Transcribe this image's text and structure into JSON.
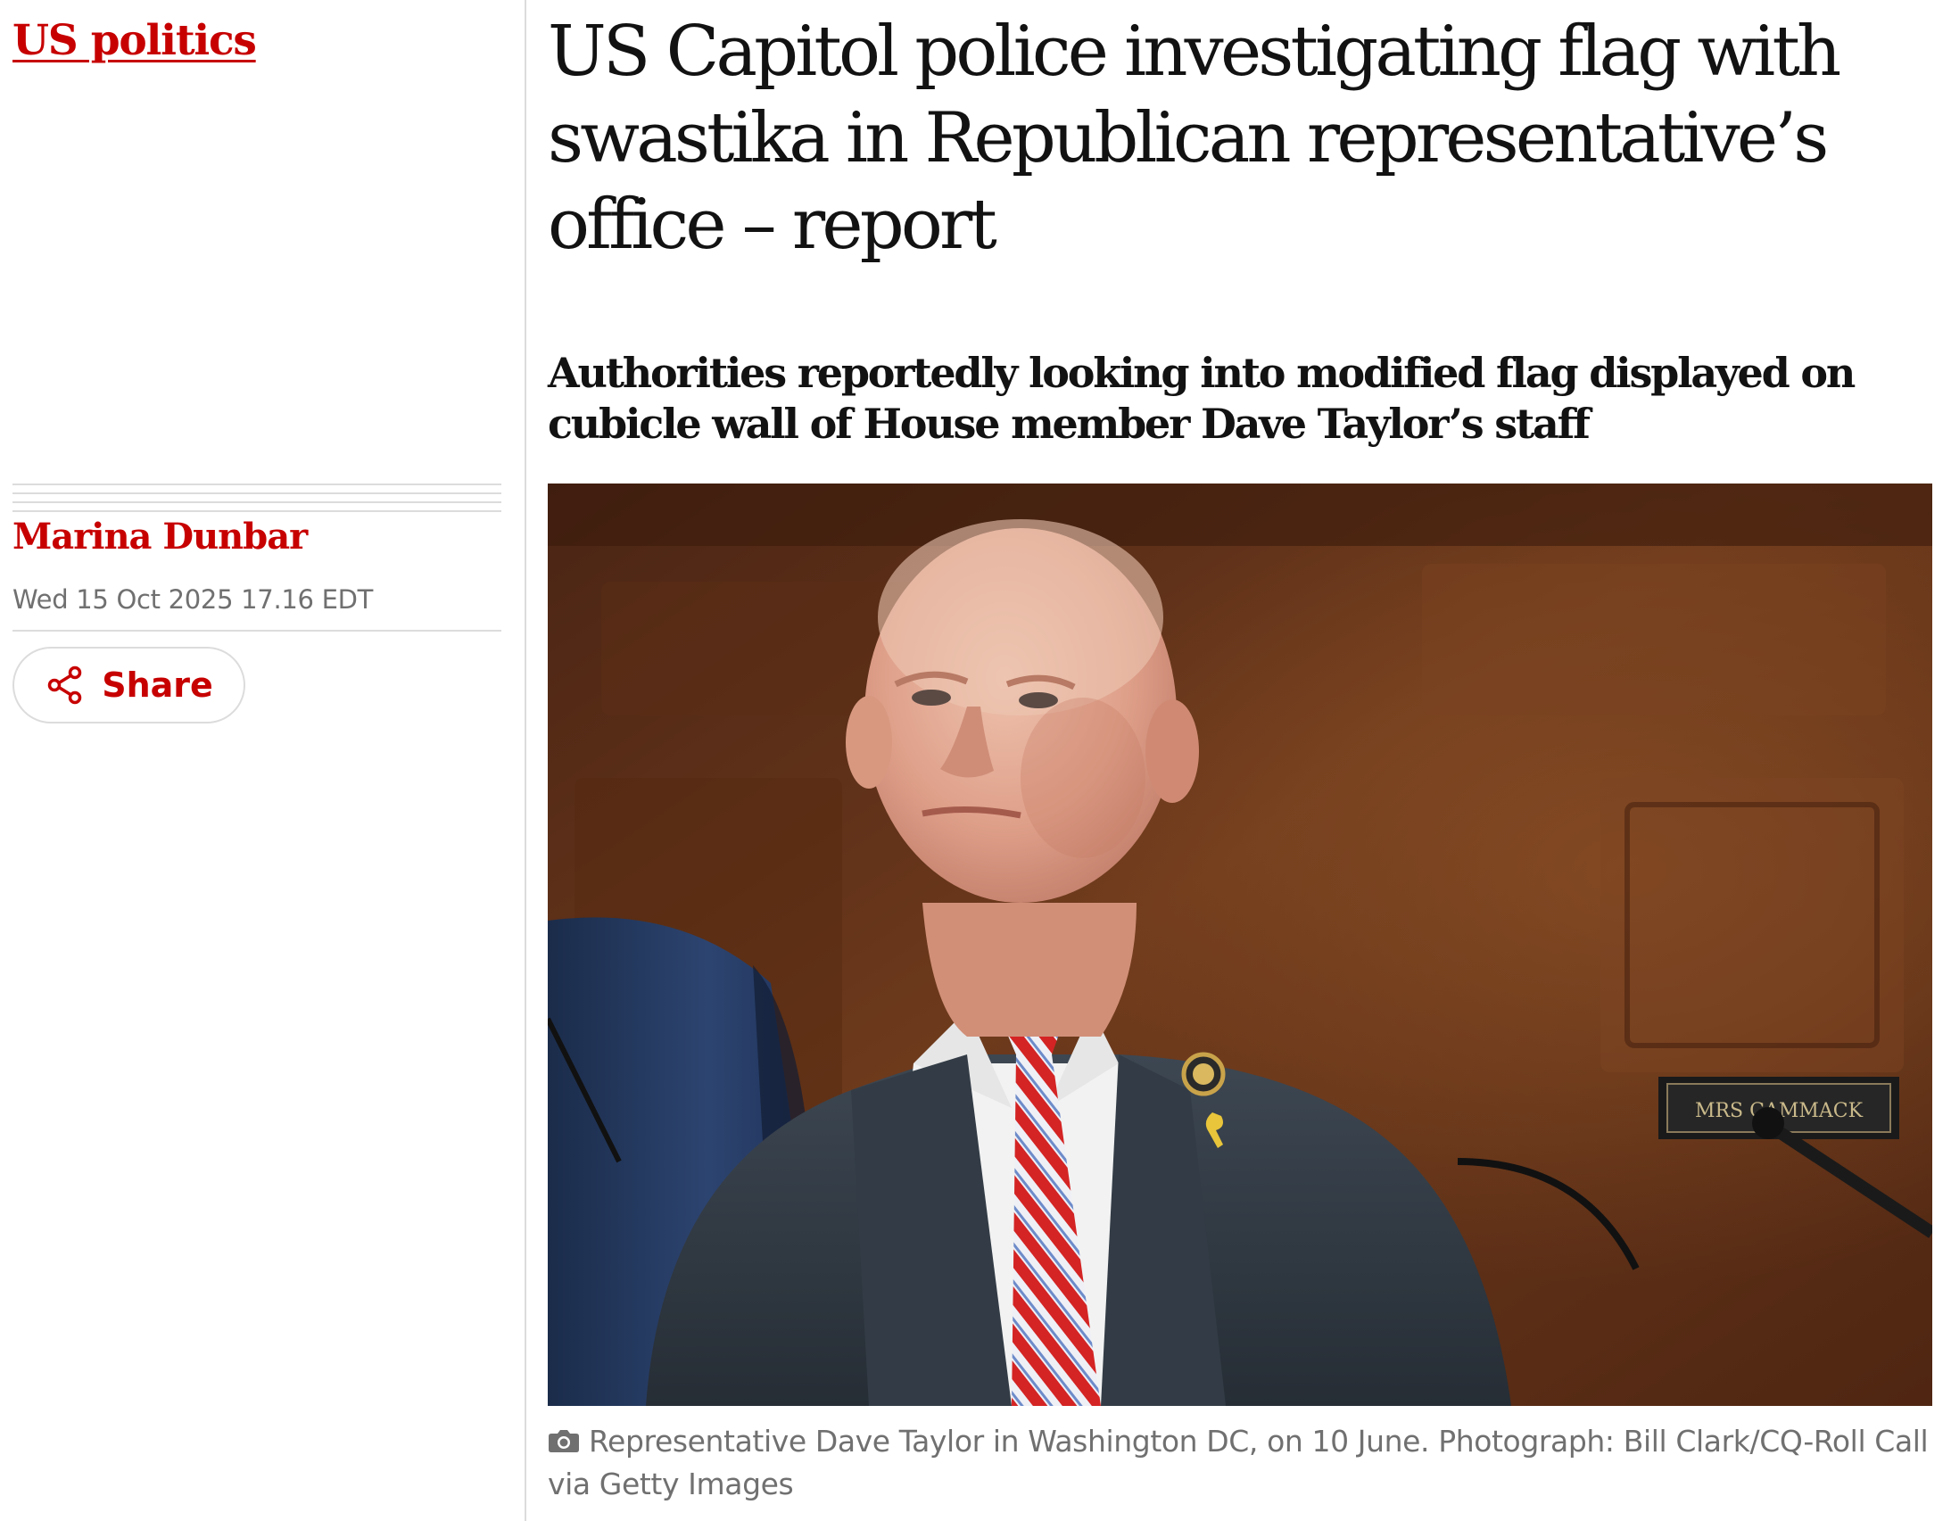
{
  "section": {
    "label": "US politics"
  },
  "article": {
    "headline": "US Capitol police investigating flag with swastika in Republican representative’s office – report",
    "standfirst": "Authorities reportedly looking into modified flag displayed on cubicle wall of House member Dave Taylor’s staff",
    "byline": "Marina Dunbar",
    "dateline": "Wed 15 Oct 2025 17.16 EDT",
    "share_label": "Share",
    "image": {
      "caption": "Representative Dave Taylor in Washington DC, on 10 June. Photograph: Bill Clark/CQ-Roll Call via Getty Images",
      "nameplate_text": "MRS CAMMACK"
    }
  },
  "icons": {
    "share": "share-icon",
    "camera": "camera-icon"
  },
  "colors": {
    "brand_red": "#c70000",
    "text": "#121212",
    "secondary_text": "#707070",
    "divider": "#dcdcdc",
    "background": "#ffffff"
  }
}
